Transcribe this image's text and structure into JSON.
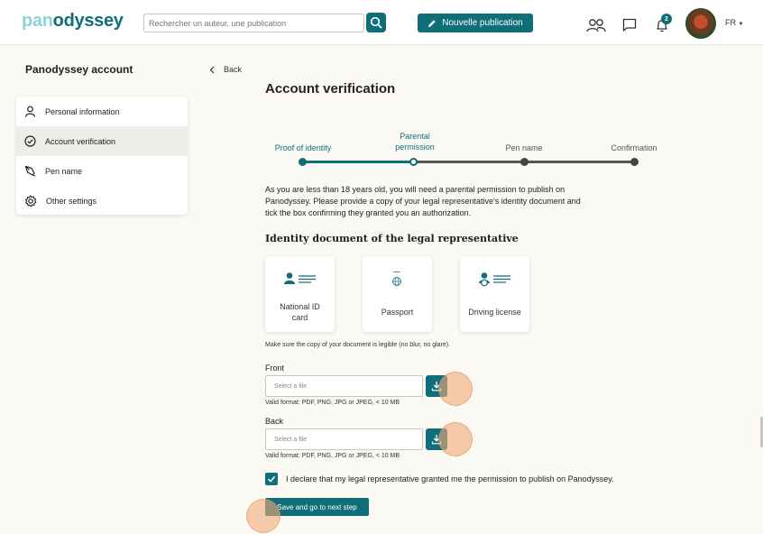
{
  "app": {
    "logo_part1": "pan",
    "logo_part2": "odyssey"
  },
  "header": {
    "search_placeholder": "Rechercher un auteur, une publication",
    "new_publication_label": "Nouvelle publication",
    "notification_count": "2",
    "language": "FR"
  },
  "sidebar": {
    "title": "Panodyssey account",
    "items": [
      {
        "label": "Personal information"
      },
      {
        "label": "Account verification"
      },
      {
        "label": "Pen name"
      },
      {
        "label": "Other settings"
      }
    ]
  },
  "back_label": "Back",
  "main": {
    "title": "Account verification",
    "steps": [
      {
        "label": "Proof of identity"
      },
      {
        "label": "Parental\npermission"
      },
      {
        "label": "Pen name"
      },
      {
        "label": "Confirmation"
      }
    ],
    "intro": "As you are less than 18 years old, you will need a parental permission to publish on Panodyssey. Please provide a copy of your legal representative's identity document and tick the box confirming they granted you an authorization.",
    "id_section_title": "Identity document of the legal representative",
    "documents": [
      {
        "label": "National ID\ncard",
        "icon": "id-card-icon"
      },
      {
        "label": "Passport",
        "icon": "passport-icon"
      },
      {
        "label": "Driving license",
        "icon": "driving-license-icon"
      }
    ],
    "legible_note": "Make sure the copy of your document is legible (no blur, no glare).",
    "front": {
      "label": "Front",
      "placeholder": "Select a file",
      "valid_format": "Valid format: PDF, PNG, JPG or JPEG, < 10 MB"
    },
    "back": {
      "label": "Back",
      "placeholder": "Select a file",
      "valid_format": "Valid format: PDF, PNG, JPG or JPEG, < 10 MB"
    },
    "declaration": "I declare that my legal representative granted me the permission to publish on Panodyssey.",
    "submit_label": "Save and go to next step"
  },
  "colors": {
    "accent": "#0f6e78",
    "logo_light": "#8fd3d6",
    "background": "#fbf9f4"
  }
}
